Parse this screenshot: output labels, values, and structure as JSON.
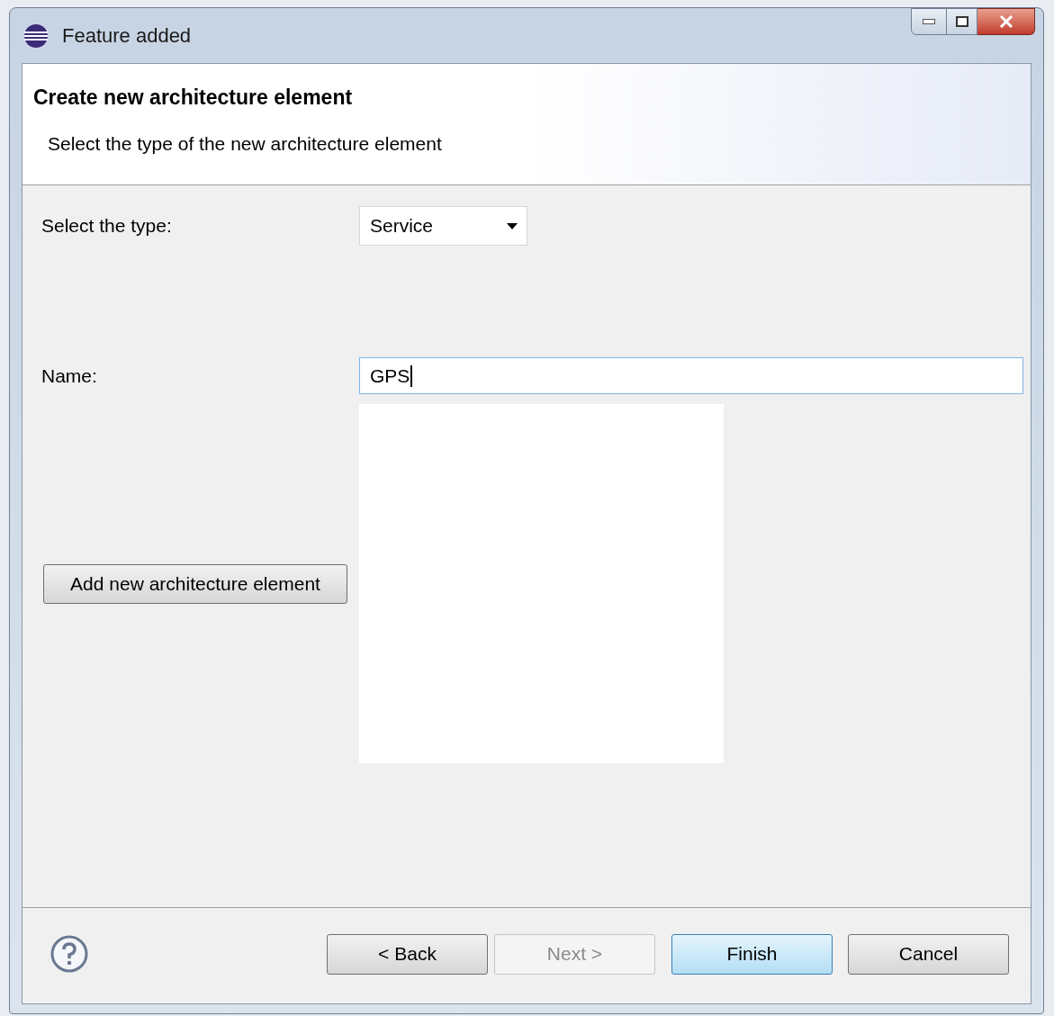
{
  "window": {
    "title": "Feature added"
  },
  "header": {
    "title": "Create new architecture element",
    "description": "Select the type of the new architecture element"
  },
  "type_field": {
    "label": "Select the type:",
    "value": "Service"
  },
  "name_field": {
    "label": "Name:",
    "value": "GPS"
  },
  "add_button": {
    "label": "Add new architecture element"
  },
  "buttons": [
    {
      "label": "< Back",
      "disabled": false,
      "default": false
    },
    {
      "label": "Next >",
      "disabled": true,
      "default": false
    },
    {
      "label": "Finish",
      "disabled": false,
      "default": true
    },
    {
      "label": "Cancel",
      "disabled": false,
      "default": false
    }
  ]
}
